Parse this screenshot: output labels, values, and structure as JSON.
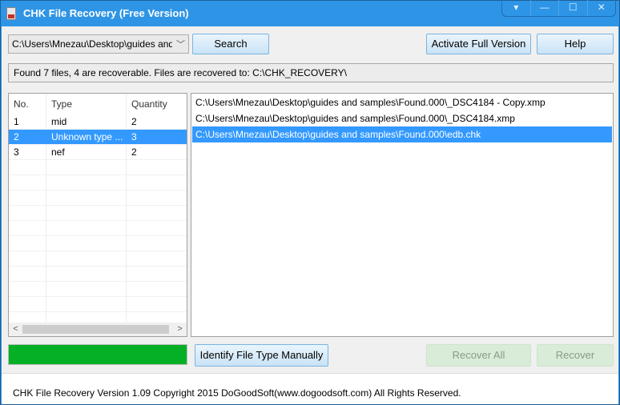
{
  "window": {
    "title": "CHK File Recovery (Free Version)",
    "controls": {
      "dropdown": "▾",
      "minimize": "—",
      "maximize": "☐",
      "close": "✕"
    }
  },
  "toolbar": {
    "path_value": "C:\\Users\\Mnezau\\Desktop\\guides and samples",
    "path_display": "C:\\Users\\Mnezau\\Desktop\\guides and sa",
    "search_label": "Search",
    "activate_label": "Activate Full Version",
    "help_label": "Help"
  },
  "status": "Found 7 files, 4 are recoverable. Files are recovered to: C:\\CHK_RECOVERY\\",
  "type_table": {
    "columns": [
      "No.",
      "Type",
      "Quantity"
    ],
    "rows": [
      {
        "no": "1",
        "type": "mid",
        "quantity": "2",
        "selected": false
      },
      {
        "no": "2",
        "type": "Unknown type ...",
        "quantity": "3",
        "selected": true
      },
      {
        "no": "3",
        "type": "nef",
        "quantity": "2",
        "selected": false
      }
    ]
  },
  "files": [
    {
      "path": "C:\\Users\\Mnezau\\Desktop\\guides and samples\\Found.000\\_DSC4184 - Copy.xmp",
      "selected": false
    },
    {
      "path": "C:\\Users\\Mnezau\\Desktop\\guides and samples\\Found.000\\_DSC4184.xmp",
      "selected": false
    },
    {
      "path": "C:\\Users\\Mnezau\\Desktop\\guides and samples\\Found.000\\edb.chk",
      "selected": true
    }
  ],
  "progress_percent": 100,
  "actions": {
    "identify_label": "Identify File Type Manually",
    "recover_all_label": "Recover All",
    "recover_label": "Recover"
  },
  "footer": "CHK File Recovery Version 1.09  Copyright 2015 DoGoodSoft(www.dogoodsoft.com) All Rights Reserved."
}
